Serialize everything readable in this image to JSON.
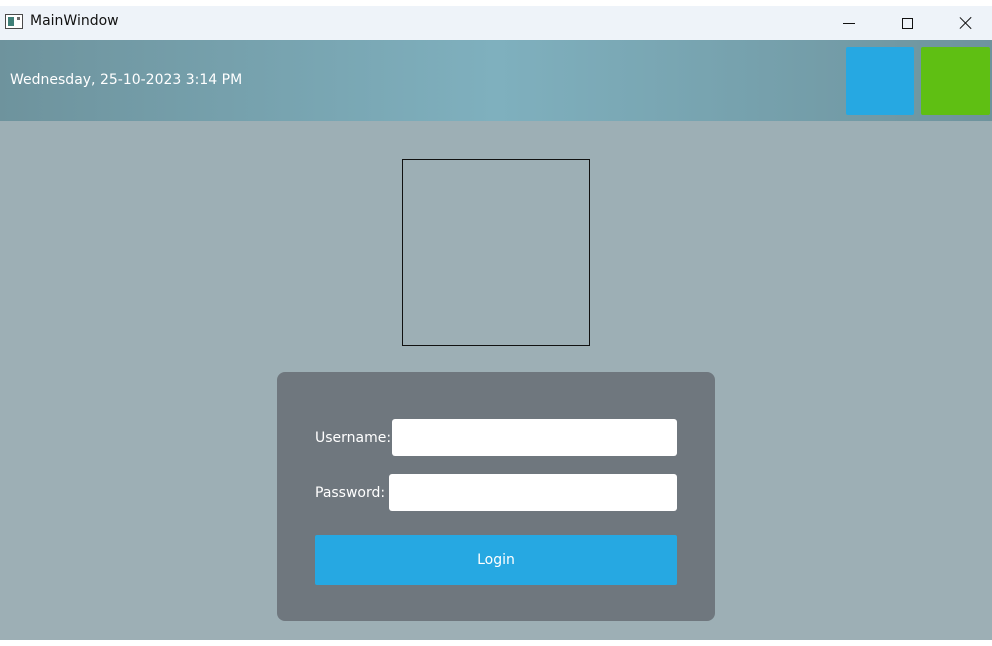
{
  "window": {
    "title": "MainWindow",
    "icon": "app-window-icon",
    "controls": {
      "minimize_icon": "minimize-icon",
      "maximize_icon": "maximize-icon",
      "close_icon": "close-icon"
    }
  },
  "header": {
    "datetime": "Wednesday, 25-10-2023 3:14 PM",
    "tiles": [
      {
        "color": "#26a8e2"
      },
      {
        "color": "#5fbf13"
      }
    ]
  },
  "login": {
    "username_label": "Username:",
    "username_value": "",
    "password_label": "Password:",
    "password_value": "",
    "button_label": "Login"
  },
  "colors": {
    "header_gradient_edge": "#6e939d",
    "header_gradient_center": "#7fb0be",
    "content_background": "#9dafb5",
    "card_background": "#6f777e",
    "accent": "#26a8e2"
  }
}
